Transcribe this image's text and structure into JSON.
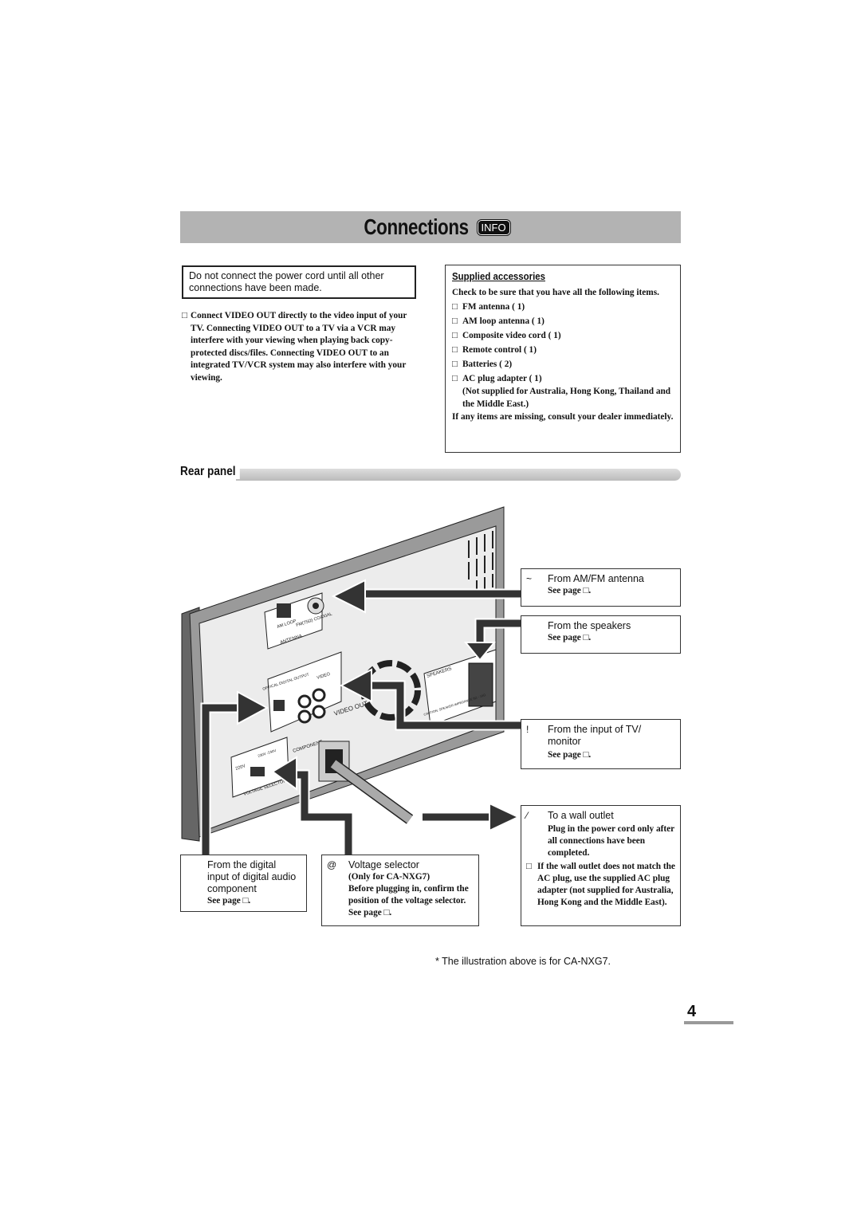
{
  "header": {
    "title": "Connections",
    "badge": "INFO"
  },
  "warning": "Do not connect the power cord until all other connections have been made.",
  "note": {
    "bullet": "□",
    "text": "Connect VIDEO OUT directly to the video input of your TV. Connecting VIDEO OUT to a TV via a VCR may interfere with your viewing when playing back copy-protected discs/files. Connecting VIDEO OUT to an integrated TV/VCR system may also interfere with your viewing."
  },
  "accessories": {
    "title": "Supplied accessories",
    "intro": "Check to be sure that you have all the following items.",
    "items": [
      {
        "mark": "□",
        "text": "FM antenna (  1)"
      },
      {
        "mark": "□",
        "text": "AM loop antenna (  1)"
      },
      {
        "mark": "□",
        "text": "Composite video cord (  1)"
      },
      {
        "mark": "□",
        "text": "Remote control (  1)"
      },
      {
        "mark": "□",
        "text": "Batteries (  2)"
      },
      {
        "mark": "□",
        "text": "AC plug adapter (  1)"
      }
    ],
    "adapter_note": "(Not supplied for Australia, Hong Kong, Thailand and the Middle East.)",
    "missing": "If any items are missing, consult your dealer immediately."
  },
  "rear_panel": {
    "title": "Rear panel"
  },
  "diagram_labels": {
    "antenna": "ANTENNA",
    "am_loop": "AM LOOP",
    "fm": "FM(75Ω) COAXIAL",
    "optical": "OPTICAL DIGITAL OUTPUT",
    "video": "VIDEO",
    "video_out": "VIDEO OUT",
    "component": "COMPONENT",
    "speakers": "SPEAKERS",
    "caution": "CAUTION: SPEAKER IMPEDANCE 8Ω - 16Ω",
    "v220": "220V",
    "v230": "230V -240V",
    "voltage_selector": "VOLTAGE SELECTOR"
  },
  "callouts": {
    "antenna": {
      "mark": "~",
      "heading": "From AM/FM antenna",
      "sub": "See page □."
    },
    "speakers": {
      "mark": "",
      "heading": "From the speakers",
      "sub": "See page □."
    },
    "tv": {
      "mark": "!",
      "heading": "From the input of TV/ monitor",
      "sub": "See page □."
    },
    "outlet": {
      "mark": "⁄",
      "heading": "To a wall outlet",
      "sub": "Plug in the power cord only after all connections have been completed.",
      "note_mark": "□",
      "note": "If the wall outlet does not match the AC plug, use the supplied AC plug adapter (not supplied for Australia, Hong Kong and the Middle East)."
    },
    "digital": {
      "heading": "From the digital input of digital audio component",
      "sub": "See page □."
    },
    "voltage": {
      "mark": "@",
      "heading": "Voltage selector",
      "model": "(Only for CA-NXG7)",
      "sub": "Before plugging in, confirm the position of the voltage selector. See page □."
    }
  },
  "footnote": "*  The illustration above is for CA-NXG7.",
  "page_number": "4"
}
